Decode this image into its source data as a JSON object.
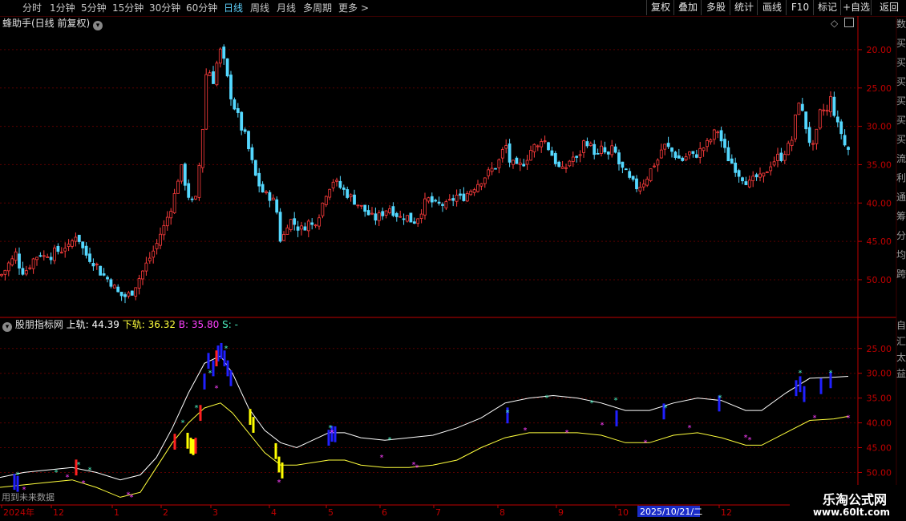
{
  "toolbar": {
    "periods": [
      "分时",
      "1分钟",
      "5分钟",
      "15分钟",
      "30分钟",
      "60分钟",
      "日线",
      "周线",
      "月线",
      "多周期",
      "更多"
    ],
    "more_arrow": ">",
    "active_period": "日线",
    "buttons": [
      "复权",
      "叠加",
      "多股",
      "统计",
      "画线",
      "F10",
      "标记",
      "+自选",
      "返回"
    ]
  },
  "main_panel": {
    "title": "蜂助手(日线 前复权)",
    "dropdown_icon": "chevron-down-icon",
    "y_ticks": [
      "50.00",
      "45.00",
      "40.00",
      "35.00",
      "30.00",
      "25.00",
      "20.00"
    ],
    "side_labels": [
      "数",
      "买",
      "买",
      "买",
      "买",
      "买",
      "买",
      "流",
      "利",
      "通",
      "筹",
      "分",
      "均",
      "跨"
    ]
  },
  "indicator_panel": {
    "name": "股朋指标网",
    "upper_label": "上轨:",
    "upper_value": "44.39",
    "lower_label": "下轨:",
    "lower_value": "36.32",
    "b_label": "B:",
    "b_value": "35.80",
    "s_label": "S:",
    "s_value": "-",
    "y_ticks": [
      "50.00",
      "45.00",
      "40.00",
      "35.00",
      "30.00",
      "25.00"
    ],
    "footnote": "用到未来数据",
    "side_labels": [
      "自",
      "汇",
      "太",
      "益"
    ]
  },
  "x_axis": {
    "labels": [
      "2024年",
      "12",
      "1",
      "2",
      "3",
      "4",
      "5",
      "6",
      "7",
      "8",
      "9",
      "10",
      "2025/10/21/二",
      "12"
    ]
  },
  "watermark": {
    "line1": "乐淘公式网",
    "line2": "www.60lt.com"
  },
  "colors": {
    "up": "#ff3c3c",
    "down": "#54d8ff",
    "grid": "#5a0000",
    "axis": "#c00000",
    "upper_band": "#ffffff",
    "lower_band": "#ffff3c",
    "blue_bar": "#2020ff",
    "cyan_star": "#4cf0c0",
    "magenta_star": "#ff40ff",
    "yellow_bar": "#ffff00"
  },
  "chart_data": {
    "type": "candlestick",
    "title": "蜂助手(日线 前复权)",
    "ylim": [
      15.5,
      52.5
    ],
    "y_ticks": [
      20,
      25,
      30,
      35,
      40,
      45,
      50
    ],
    "x_labels": [
      "2024年",
      "12",
      "1",
      "2",
      "3",
      "4",
      "5",
      "6",
      "7",
      "8",
      "9",
      "10",
      "12"
    ],
    "close_path": [
      [
        0,
        20.5
      ],
      [
        5,
        21
      ],
      [
        10,
        22
      ],
      [
        15,
        22.5
      ],
      [
        20,
        23.5
      ],
      [
        25,
        21.5
      ],
      [
        30,
        21
      ],
      [
        35,
        21.5
      ],
      [
        40,
        22.5
      ],
      [
        45,
        23
      ],
      [
        50,
        23.5
      ],
      [
        55,
        23
      ],
      [
        60,
        23.5
      ],
      [
        65,
        23
      ],
      [
        70,
        24
      ],
      [
        75,
        23.5
      ],
      [
        80,
        24.5
      ],
      [
        85,
        24
      ],
      [
        90,
        25
      ],
      [
        95,
        26
      ],
      [
        100,
        25
      ],
      [
        105,
        23.5
      ],
      [
        110,
        23
      ],
      [
        115,
        22.5
      ],
      [
        120,
        22
      ],
      [
        125,
        21
      ],
      [
        130,
        20.5
      ],
      [
        135,
        20
      ],
      [
        140,
        19.5
      ],
      [
        145,
        18.5
      ],
      [
        150,
        18
      ],
      [
        155,
        17.8
      ],
      [
        160,
        18
      ],
      [
        165,
        18.5
      ],
      [
        170,
        19.5
      ],
      [
        175,
        20.5
      ],
      [
        180,
        21.5
      ],
      [
        185,
        22.5
      ],
      [
        190,
        23.5
      ],
      [
        195,
        24.5
      ],
      [
        200,
        26
      ],
      [
        205,
        27
      ],
      [
        210,
        28.5
      ],
      [
        215,
        30
      ],
      [
        220,
        32
      ],
      [
        225,
        35
      ],
      [
        230,
        33
      ],
      [
        235,
        31
      ],
      [
        240,
        30
      ],
      [
        245,
        30.5
      ],
      [
        250,
        37
      ],
      [
        253,
        40
      ],
      [
        256,
        45
      ],
      [
        258,
        48
      ],
      [
        262,
        47
      ],
      [
        266,
        46
      ],
      [
        270,
        48
      ],
      [
        274,
        50
      ],
      [
        278,
        49
      ],
      [
        282,
        47
      ],
      [
        286,
        45
      ],
      [
        290,
        43
      ],
      [
        295,
        42
      ],
      [
        300,
        40
      ],
      [
        305,
        39
      ],
      [
        310,
        37
      ],
      [
        315,
        35
      ],
      [
        320,
        33
      ],
      [
        325,
        32
      ],
      [
        330,
        31
      ],
      [
        335,
        31
      ],
      [
        340,
        30.5
      ],
      [
        345,
        29
      ],
      [
        350,
        25
      ],
      [
        355,
        26
      ],
      [
        360,
        28
      ],
      [
        365,
        27.5
      ],
      [
        370,
        27
      ],
      [
        375,
        26.5
      ],
      [
        380,
        27
      ],
      [
        385,
        27.5
      ],
      [
        390,
        27
      ],
      [
        395,
        28
      ],
      [
        400,
        29
      ],
      [
        405,
        31
      ],
      [
        410,
        32
      ],
      [
        415,
        33
      ],
      [
        420,
        32.5
      ],
      [
        425,
        32
      ],
      [
        430,
        31.5
      ],
      [
        435,
        31
      ],
      [
        440,
        30.5
      ],
      [
        445,
        30
      ],
      [
        450,
        29.5
      ],
      [
        455,
        29
      ],
      [
        460,
        28.5
      ],
      [
        465,
        28
      ],
      [
        470,
        28
      ],
      [
        475,
        28.5
      ],
      [
        480,
        29
      ],
      [
        485,
        29.5
      ],
      [
        490,
        29
      ],
      [
        495,
        28.5
      ],
      [
        500,
        28
      ],
      [
        505,
        28.5
      ],
      [
        510,
        28
      ],
      [
        515,
        27.5
      ],
      [
        520,
        28
      ],
      [
        525,
        29
      ],
      [
        530,
        30
      ],
      [
        535,
        30.5
      ],
      [
        540,
        30
      ],
      [
        545,
        29.5
      ],
      [
        550,
        30
      ],
      [
        555,
        29.5
      ],
      [
        560,
        30
      ],
      [
        565,
        30.5
      ],
      [
        570,
        31
      ],
      [
        575,
        30.5
      ],
      [
        580,
        31
      ],
      [
        585,
        31.5
      ],
      [
        590,
        32
      ],
      [
        595,
        32.5
      ],
      [
        600,
        33
      ],
      [
        605,
        33.5
      ],
      [
        610,
        34
      ],
      [
        615,
        34.5
      ],
      [
        620,
        35
      ],
      [
        625,
        36
      ],
      [
        630,
        38
      ],
      [
        635,
        35.5
      ],
      [
        640,
        35
      ],
      [
        645,
        34.5
      ],
      [
        650,
        35
      ],
      [
        655,
        35.5
      ],
      [
        660,
        36.5
      ],
      [
        665,
        37.5
      ],
      [
        670,
        37
      ],
      [
        675,
        38.5
      ],
      [
        680,
        38
      ],
      [
        685,
        37
      ],
      [
        690,
        36
      ],
      [
        695,
        35
      ],
      [
        700,
        34
      ],
      [
        705,
        34.5
      ],
      [
        710,
        35.5
      ],
      [
        715,
        36
      ],
      [
        720,
        35.5
      ],
      [
        725,
        37
      ],
      [
        730,
        38.5
      ],
      [
        735,
        37.5
      ],
      [
        740,
        37
      ],
      [
        745,
        36
      ],
      [
        750,
        37
      ],
      [
        755,
        36.5
      ],
      [
        760,
        36
      ],
      [
        765,
        37.5
      ],
      [
        770,
        35.5
      ],
      [
        775,
        34.5
      ],
      [
        780,
        34
      ],
      [
        785,
        33
      ],
      [
        790,
        32.5
      ],
      [
        795,
        32
      ],
      [
        800,
        32.5
      ],
      [
        805,
        33
      ],
      [
        810,
        34
      ],
      [
        815,
        35
      ],
      [
        820,
        35.5
      ],
      [
        825,
        37
      ],
      [
        830,
        37.5
      ],
      [
        835,
        37
      ],
      [
        840,
        36.5
      ],
      [
        845,
        36
      ],
      [
        850,
        35.5
      ],
      [
        855,
        36
      ],
      [
        860,
        36.5
      ],
      [
        865,
        36
      ],
      [
        870,
        36.5
      ],
      [
        875,
        37
      ],
      [
        880,
        37.5
      ],
      [
        885,
        38
      ],
      [
        890,
        39
      ],
      [
        895,
        39.5
      ],
      [
        900,
        38
      ],
      [
        905,
        36.5
      ],
      [
        910,
        35.5
      ],
      [
        915,
        35
      ],
      [
        920,
        34
      ],
      [
        925,
        33.5
      ],
      [
        930,
        33
      ],
      [
        935,
        32.5
      ],
      [
        940,
        33
      ],
      [
        945,
        33.5
      ],
      [
        950,
        33
      ],
      [
        955,
        34
      ],
      [
        960,
        35
      ],
      [
        965,
        35.5
      ],
      [
        970,
        36
      ],
      [
        975,
        36
      ],
      [
        980,
        37
      ],
      [
        985,
        37.5
      ],
      [
        990,
        39
      ],
      [
        995,
        44
      ],
      [
        1000,
        42
      ],
      [
        1005,
        40
      ],
      [
        1010,
        38
      ],
      [
        1015,
        37
      ],
      [
        1020,
        40
      ],
      [
        1025,
        43
      ],
      [
        1030,
        41
      ],
      [
        1035,
        44
      ],
      [
        1040,
        42
      ],
      [
        1045,
        40
      ],
      [
        1050,
        39
      ],
      [
        1055,
        37
      ]
    ],
    "indicator": {
      "ylim": [
        22,
        54
      ],
      "y_ticks": [
        25,
        30,
        35,
        40,
        45,
        50
      ],
      "upper_band": [
        [
          0,
          24
        ],
        [
          30,
          25
        ],
        [
          60,
          25.5
        ],
        [
          90,
          26
        ],
        [
          120,
          25
        ],
        [
          150,
          23.5
        ],
        [
          175,
          24.5
        ],
        [
          195,
          28
        ],
        [
          215,
          34
        ],
        [
          235,
          41
        ],
        [
          255,
          47
        ],
        [
          275,
          48.5
        ],
        [
          290,
          45
        ],
        [
          310,
          38
        ],
        [
          330,
          33.5
        ],
        [
          350,
          31
        ],
        [
          370,
          30
        ],
        [
          390,
          31.5
        ],
        [
          410,
          33
        ],
        [
          430,
          33
        ],
        [
          450,
          32
        ],
        [
          480,
          31.5
        ],
        [
          510,
          32
        ],
        [
          540,
          32.5
        ],
        [
          570,
          34
        ],
        [
          600,
          36
        ],
        [
          630,
          39
        ],
        [
          660,
          40
        ],
        [
          690,
          40.5
        ],
        [
          720,
          40
        ],
        [
          750,
          39
        ],
        [
          780,
          37.5
        ],
        [
          810,
          37.5
        ],
        [
          840,
          39
        ],
        [
          870,
          40
        ],
        [
          900,
          39.5
        ],
        [
          930,
          37.5
        ],
        [
          950,
          37.5
        ],
        [
          980,
          41
        ],
        [
          1010,
          44
        ],
        [
          1040,
          44.2
        ],
        [
          1058,
          44.39
        ]
      ],
      "lower_band": [
        [
          0,
          22
        ],
        [
          30,
          22.5
        ],
        [
          60,
          23
        ],
        [
          90,
          23.5
        ],
        [
          120,
          22
        ],
        [
          150,
          20
        ],
        [
          175,
          21
        ],
        [
          195,
          26
        ],
        [
          215,
          31
        ],
        [
          235,
          35
        ],
        [
          255,
          38
        ],
        [
          275,
          39
        ],
        [
          290,
          37
        ],
        [
          310,
          33
        ],
        [
          330,
          29
        ],
        [
          350,
          26.5
        ],
        [
          370,
          26.5
        ],
        [
          390,
          27
        ],
        [
          410,
          27.5
        ],
        [
          430,
          27.5
        ],
        [
          450,
          26.5
        ],
        [
          480,
          26
        ],
        [
          510,
          26
        ],
        [
          540,
          26.5
        ],
        [
          570,
          27.5
        ],
        [
          600,
          30
        ],
        [
          630,
          32
        ],
        [
          660,
          33
        ],
        [
          690,
          33
        ],
        [
          720,
          33
        ],
        [
          750,
          32.5
        ],
        [
          780,
          31
        ],
        [
          810,
          31
        ],
        [
          840,
          32.5
        ],
        [
          870,
          33
        ],
        [
          900,
          32
        ],
        [
          930,
          30.5
        ],
        [
          950,
          30.5
        ],
        [
          980,
          33
        ],
        [
          1010,
          35.5
        ],
        [
          1040,
          35.8
        ],
        [
          1058,
          36.32
        ]
      ]
    }
  }
}
